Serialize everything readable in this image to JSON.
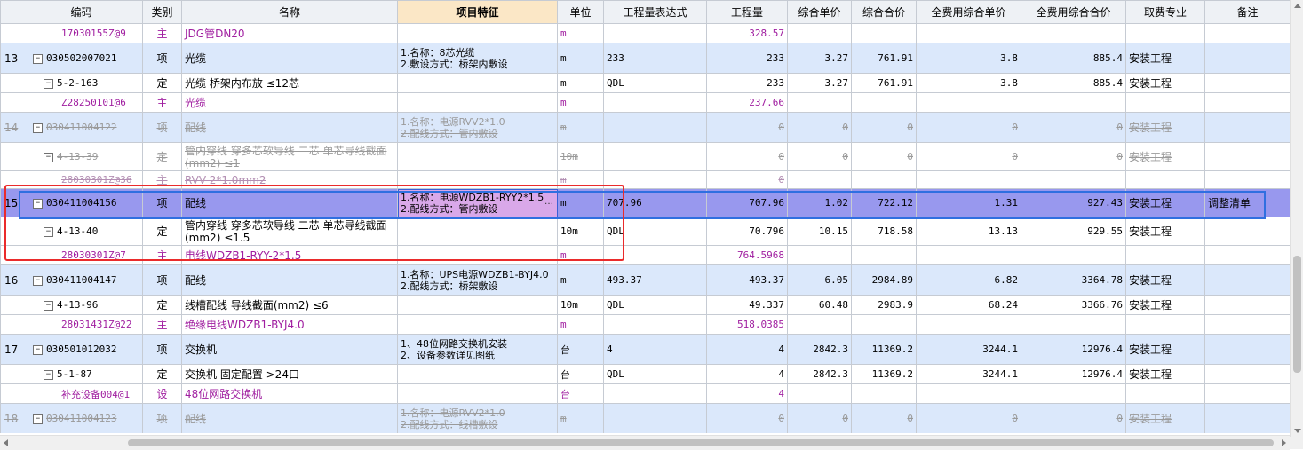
{
  "headers": {
    "code": "编码",
    "type": "类别",
    "name": "名称",
    "feature": "项目特征",
    "unit": "单位",
    "expr": "工程量表达式",
    "qty": "工程量",
    "unit_price": "综合单价",
    "total": "综合合价",
    "full_unit": "全费用综合单价",
    "full_total": "全费用综合合价",
    "category": "取费专业",
    "remark": "备注"
  },
  "rows": [
    {
      "seq": "",
      "code": "17030155Z@9",
      "type": "主",
      "name": "JDG管DN20",
      "feature": "",
      "unit": "m",
      "expr": "",
      "qty": "328.57",
      "unit_price": "",
      "total": "",
      "full_unit": "",
      "full_total": "",
      "category": "",
      "remark": ""
    },
    {
      "seq": "13",
      "code": "030502007021",
      "type": "项",
      "name": "光缆",
      "feature": "1.名称：8芯光缆\n2.敷设方式：桥架内敷设",
      "unit": "m",
      "expr": "233",
      "qty": "233",
      "unit_price": "3.27",
      "total": "761.91",
      "full_unit": "3.8",
      "full_total": "885.4",
      "category": "安装工程",
      "remark": ""
    },
    {
      "seq": "",
      "code": "5-2-163",
      "type": "定",
      "name": "光缆 桥架内布放 ≤12芯",
      "feature": "",
      "unit": "m",
      "expr": "QDL",
      "qty": "233",
      "unit_price": "3.27",
      "total": "761.91",
      "full_unit": "3.8",
      "full_total": "885.4",
      "category": "安装工程",
      "remark": ""
    },
    {
      "seq": "",
      "code": "Z28250101@6",
      "type": "主",
      "name": "光缆",
      "feature": "",
      "unit": "m",
      "expr": "",
      "qty": "237.66",
      "unit_price": "",
      "total": "",
      "full_unit": "",
      "full_total": "",
      "category": "",
      "remark": ""
    },
    {
      "seq": "14",
      "code": "030411004122",
      "type": "项",
      "name": "配线",
      "feature": "1.名称：电源RVV2*1.0\n2.配线方式：管内敷设",
      "unit": "m",
      "expr": "",
      "qty": "0",
      "unit_price": "0",
      "total": "0",
      "full_unit": "0",
      "full_total": "0",
      "category": "安装工程",
      "remark": ""
    },
    {
      "seq": "",
      "code": "4-13-39",
      "type": "定",
      "name": "管内穿线 穿多芯软导线 二芯 单芯导线截面(mm2) ≤1",
      "feature": "",
      "unit": "10m",
      "expr": "",
      "qty": "0",
      "unit_price": "0",
      "total": "0",
      "full_unit": "0",
      "full_total": "0",
      "category": "安装工程",
      "remark": ""
    },
    {
      "seq": "",
      "code": "28030301Z@36",
      "type": "主",
      "name": "RVV-2*1.0mm2",
      "feature": "",
      "unit": "m",
      "expr": "",
      "qty": "0",
      "unit_price": "",
      "total": "",
      "full_unit": "",
      "full_total": "",
      "category": "",
      "remark": ""
    },
    {
      "seq": "15",
      "code": "030411004156",
      "type": "项",
      "name": "配线",
      "feature": "1.名称：电源WDZB1-RYY2*1.5\n2.配线方式：管内敷设",
      "unit": "m",
      "expr": "707.96",
      "qty": "707.96",
      "unit_price": "1.02",
      "total": "722.12",
      "full_unit": "1.31",
      "full_total": "927.43",
      "category": "安装工程",
      "remark": "调整清单"
    },
    {
      "seq": "",
      "code": "4-13-40",
      "type": "定",
      "name": "管内穿线 穿多芯软导线 二芯 单芯导线截面(mm2) ≤1.5",
      "feature": "",
      "unit": "10m",
      "expr": "QDL",
      "qty": "70.796",
      "unit_price": "10.15",
      "total": "718.58",
      "full_unit": "13.13",
      "full_total": "929.55",
      "category": "安装工程",
      "remark": ""
    },
    {
      "seq": "",
      "code": "28030301Z@7",
      "type": "主",
      "name": "电线WDZB1-RYY-2*1.5",
      "feature": "",
      "unit": "m",
      "expr": "",
      "qty": "764.5968",
      "unit_price": "",
      "total": "",
      "full_unit": "",
      "full_total": "",
      "category": "",
      "remark": ""
    },
    {
      "seq": "16",
      "code": "030411004147",
      "type": "项",
      "name": "配线",
      "feature": "1.名称：UPS电源WDZB1-BYJ4.0\n2.配线方式：桥架敷设",
      "unit": "m",
      "expr": "493.37",
      "qty": "493.37",
      "unit_price": "6.05",
      "total": "2984.89",
      "full_unit": "6.82",
      "full_total": "3364.78",
      "category": "安装工程",
      "remark": ""
    },
    {
      "seq": "",
      "code": "4-13-96",
      "type": "定",
      "name": "线槽配线 导线截面(mm2) ≤6",
      "feature": "",
      "unit": "10m",
      "expr": "QDL",
      "qty": "49.337",
      "unit_price": "60.48",
      "total": "2983.9",
      "full_unit": "68.24",
      "full_total": "3366.76",
      "category": "安装工程",
      "remark": ""
    },
    {
      "seq": "",
      "code": "28031431Z@22",
      "type": "主",
      "name": "绝缘电线WDZB1-BYJ4.0",
      "feature": "",
      "unit": "m",
      "expr": "",
      "qty": "518.0385",
      "unit_price": "",
      "total": "",
      "full_unit": "",
      "full_total": "",
      "category": "",
      "remark": ""
    },
    {
      "seq": "17",
      "code": "030501012032",
      "type": "项",
      "name": "交换机",
      "feature": "1、48位网路交换机安装\n2、设备参数详见图纸",
      "unit": "台",
      "expr": "4",
      "qty": "4",
      "unit_price": "2842.3",
      "total": "11369.2",
      "full_unit": "3244.1",
      "full_total": "12976.4",
      "category": "安装工程",
      "remark": ""
    },
    {
      "seq": "",
      "code": "5-1-87",
      "type": "定",
      "name": "交换机 固定配置 >24口",
      "feature": "",
      "unit": "台",
      "expr": "QDL",
      "qty": "4",
      "unit_price": "2842.3",
      "total": "11369.2",
      "full_unit": "3244.1",
      "full_total": "12976.4",
      "category": "安装工程",
      "remark": ""
    },
    {
      "seq": "",
      "code": "补充设备004@1",
      "type": "设",
      "name": "48位网路交换机",
      "feature": "",
      "unit": "台",
      "expr": "",
      "qty": "4",
      "unit_price": "",
      "total": "",
      "full_unit": "",
      "full_total": "",
      "category": "",
      "remark": ""
    },
    {
      "seq": "18",
      "code": "030411004123",
      "type": "项",
      "name": "配线",
      "feature": "1.名称：电源RVV2*1.0\n2.配线方式：线槽敷设",
      "unit": "m",
      "expr": "",
      "qty": "0",
      "unit_price": "0",
      "total": "0",
      "full_unit": "0",
      "full_total": "0",
      "category": "安装工程",
      "remark": ""
    }
  ],
  "ellipsis": "…"
}
